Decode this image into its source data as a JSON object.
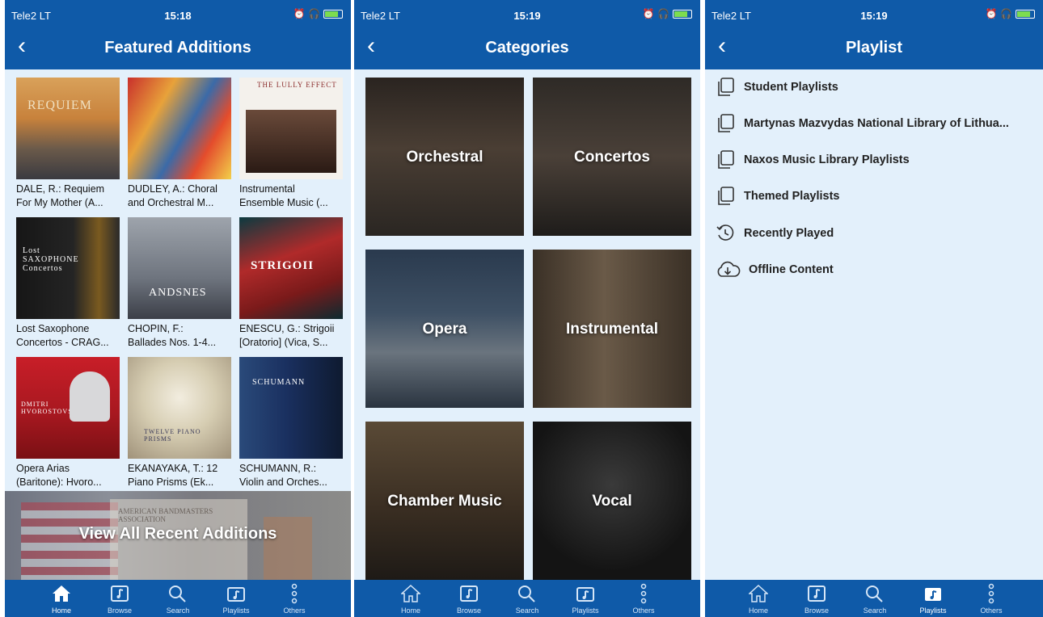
{
  "status_bar": {
    "carrier": "Tele2 LT",
    "time_1": "15:18",
    "time_2": "15:19",
    "time_3": "15:19"
  },
  "screen1": {
    "title": "Featured Additions",
    "albums": [
      {
        "line1": "DALE, R.: Requiem",
        "line2": "For My Mother (A...",
        "cover_text": "REQUIEM"
      },
      {
        "line1": "DUDLEY, A.: Choral",
        "line2": "and Orchestral M...",
        "cover_text": ""
      },
      {
        "line1": "Instrumental",
        "line2": "Ensemble Music (...",
        "cover_text": "THE LULLY EFFECT"
      },
      {
        "line1": "Lost Saxophone",
        "line2": "Concertos - CRAG...",
        "cover_text": "Lost SAXOPHONE Concertos"
      },
      {
        "line1": "CHOPIN, F.:",
        "line2": "Ballades Nos. 1-4...",
        "cover_text": "ANDSNES"
      },
      {
        "line1": "ENESCU, G.: Strigoii",
        "line2": "[Oratorio] (Vica, S...",
        "cover_text": "STRIGOII"
      },
      {
        "line1": "Opera Arias",
        "line2": "(Baritone): Hvoro...",
        "cover_text": "DMITRI HVOROSTOVSKY"
      },
      {
        "line1": "EKANAYAKA, T.: 12",
        "line2": "Piano Prisms (Ek...",
        "cover_text": "TWELVE PIANO PRISMS"
      },
      {
        "line1": "SCHUMANN, R.:",
        "line2": "Violin and Orches...",
        "cover_text": "SCHUMANN"
      }
    ],
    "view_all_label": "View All Recent Additions",
    "view_all_cover_text": "AMERICAN BANDMASTERS ASSOCIATION"
  },
  "screen2": {
    "title": "Categories",
    "categories": [
      "Orchestral",
      "Concertos",
      "Opera",
      "Instrumental",
      "Chamber Music",
      "Vocal"
    ]
  },
  "screen3": {
    "title": "Playlist",
    "items": [
      {
        "label": "Student Playlists",
        "icon": "playlist-folder-icon"
      },
      {
        "label": "Martynas Mazvydas National Library of Lithua...",
        "icon": "playlist-folder-icon"
      },
      {
        "label": "Naxos Music Library Playlists",
        "icon": "playlist-folder-icon"
      },
      {
        "label": "Themed Playlists",
        "icon": "playlist-folder-icon"
      },
      {
        "label": "Recently Played",
        "icon": "history-icon"
      },
      {
        "label": "Offline Content",
        "icon": "cloud-download-icon"
      }
    ]
  },
  "tabs": [
    "Home",
    "Browse",
    "Search",
    "Playlists",
    "Others"
  ],
  "active_tabs": {
    "screen1": "Home",
    "screen2": "none",
    "screen3": "Playlists"
  },
  "colors": {
    "brand_blue": "#0f5aa8",
    "content_bg": "#e3f0fb"
  }
}
